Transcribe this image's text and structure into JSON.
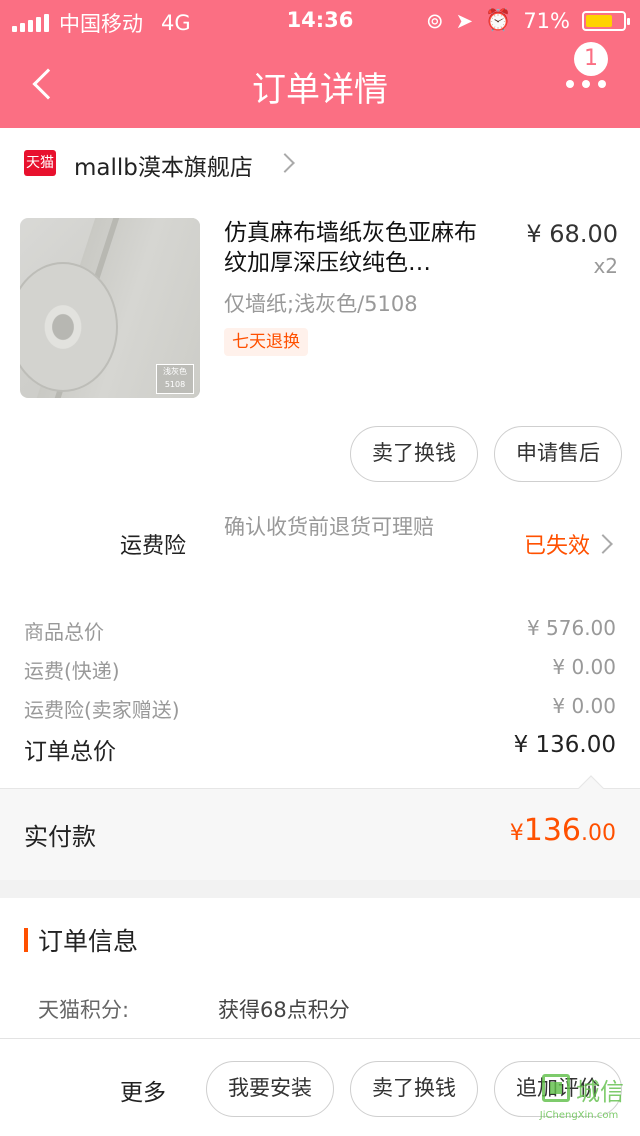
{
  "status_bar": {
    "carrier": "中国移动",
    "network": "4G",
    "time": "14:36",
    "battery": "71%",
    "battery_level": 0.71
  },
  "header": {
    "title": "订单详情",
    "badge_count": "1"
  },
  "shop": {
    "logo_text": "天猫",
    "name": "mallb漠本旗舰店"
  },
  "product": {
    "title": "仿真麻布墙纸灰色亚麻布纹加厚深压纹纯色…",
    "price": "¥ 68.00",
    "quantity": "x2",
    "sku": "仅墙纸;浅灰色/5108",
    "tag": "七天退换",
    "swatch_label_1": "浅灰色",
    "swatch_label_2": "5108"
  },
  "actions": {
    "sell_label": "卖了换钱",
    "after_sale_label": "申请售后"
  },
  "insurance": {
    "label": "运费险",
    "description": "确认收货前退货可理赔",
    "status": "已失效"
  },
  "summary": {
    "goods_label": "商品总价",
    "goods_value": "¥ 576.00",
    "shipping_label": "运费(快递)",
    "shipping_value": "¥ 0.00",
    "ins_label": "运费险(卖家赠送)",
    "ins_value": "¥ 0.00",
    "total_label": "订单总价",
    "total_value": "¥ 136.00"
  },
  "payment": {
    "label": "实付款",
    "currency": "¥",
    "amount_int": "136",
    "amount_dec": ".00"
  },
  "order_info": {
    "title": "订单信息",
    "points_label": "天猫积分:",
    "points_value": "获得68点积分"
  },
  "bottom": {
    "more_label": "更多",
    "install_label": "我要安装",
    "sell_label": "卖了换钱",
    "review_label": "追加评价"
  },
  "watermark": {
    "glyphs": "城信",
    "domain": "JiChengXin.com"
  },
  "colors": {
    "header": "#fb6f83",
    "accent": "#ff5000",
    "tmall": "#e8112e",
    "battery": "#ffd200"
  }
}
